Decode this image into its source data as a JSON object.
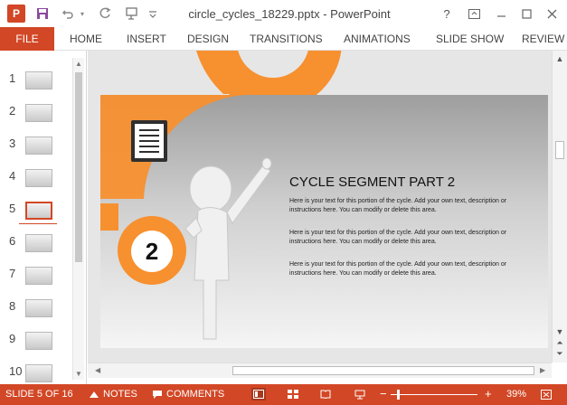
{
  "window": {
    "title": "circle_cycles_18229.pptx - PowerPoint",
    "help": "?",
    "ribbon_display": "⧉",
    "minimize": "—",
    "restore": "▢",
    "close": "✕"
  },
  "qat": {
    "app_logo": "P",
    "save_icon": "💾",
    "undo_icon": "↶",
    "redo_icon": "↻",
    "present_icon": "⊡",
    "customize_icon": "⌄"
  },
  "ribbon": {
    "file": "FILE",
    "tabs": [
      "HOME",
      "INSERT",
      "DESIGN",
      "TRANSITIONS",
      "ANIMATIONS",
      "SLIDE SHOW",
      "REVIEW"
    ]
  },
  "thumbnails": [
    "1",
    "2",
    "3",
    "4",
    "5",
    "6",
    "7",
    "8",
    "9",
    "10"
  ],
  "active_slide_index": 5,
  "slide": {
    "title": "CYCLE SEGMENT PART 2",
    "number": "2",
    "paragraphs": [
      "Here is your text for this portion of the cycle. Add your own text, description or instructions here. You can modify or delete this area.",
      "Here is your text for this portion of the cycle. Add your own text, description or instructions here. You can modify or delete this area.",
      "Here is your text for this portion of the cycle. Add your own text, description or instructions here. You can modify or delete this area."
    ],
    "colors": {
      "accent": "#f7902f",
      "figure": "#f2f2f2"
    }
  },
  "status": {
    "slide_info": "SLIDE 5 OF 16",
    "notes": "NOTES",
    "comments": "COMMENTS",
    "zoom_label": "39%",
    "zoom_minus": "−",
    "zoom_plus": "+",
    "zoom_percent": 39
  },
  "colors": {
    "brand": "#d24726"
  }
}
